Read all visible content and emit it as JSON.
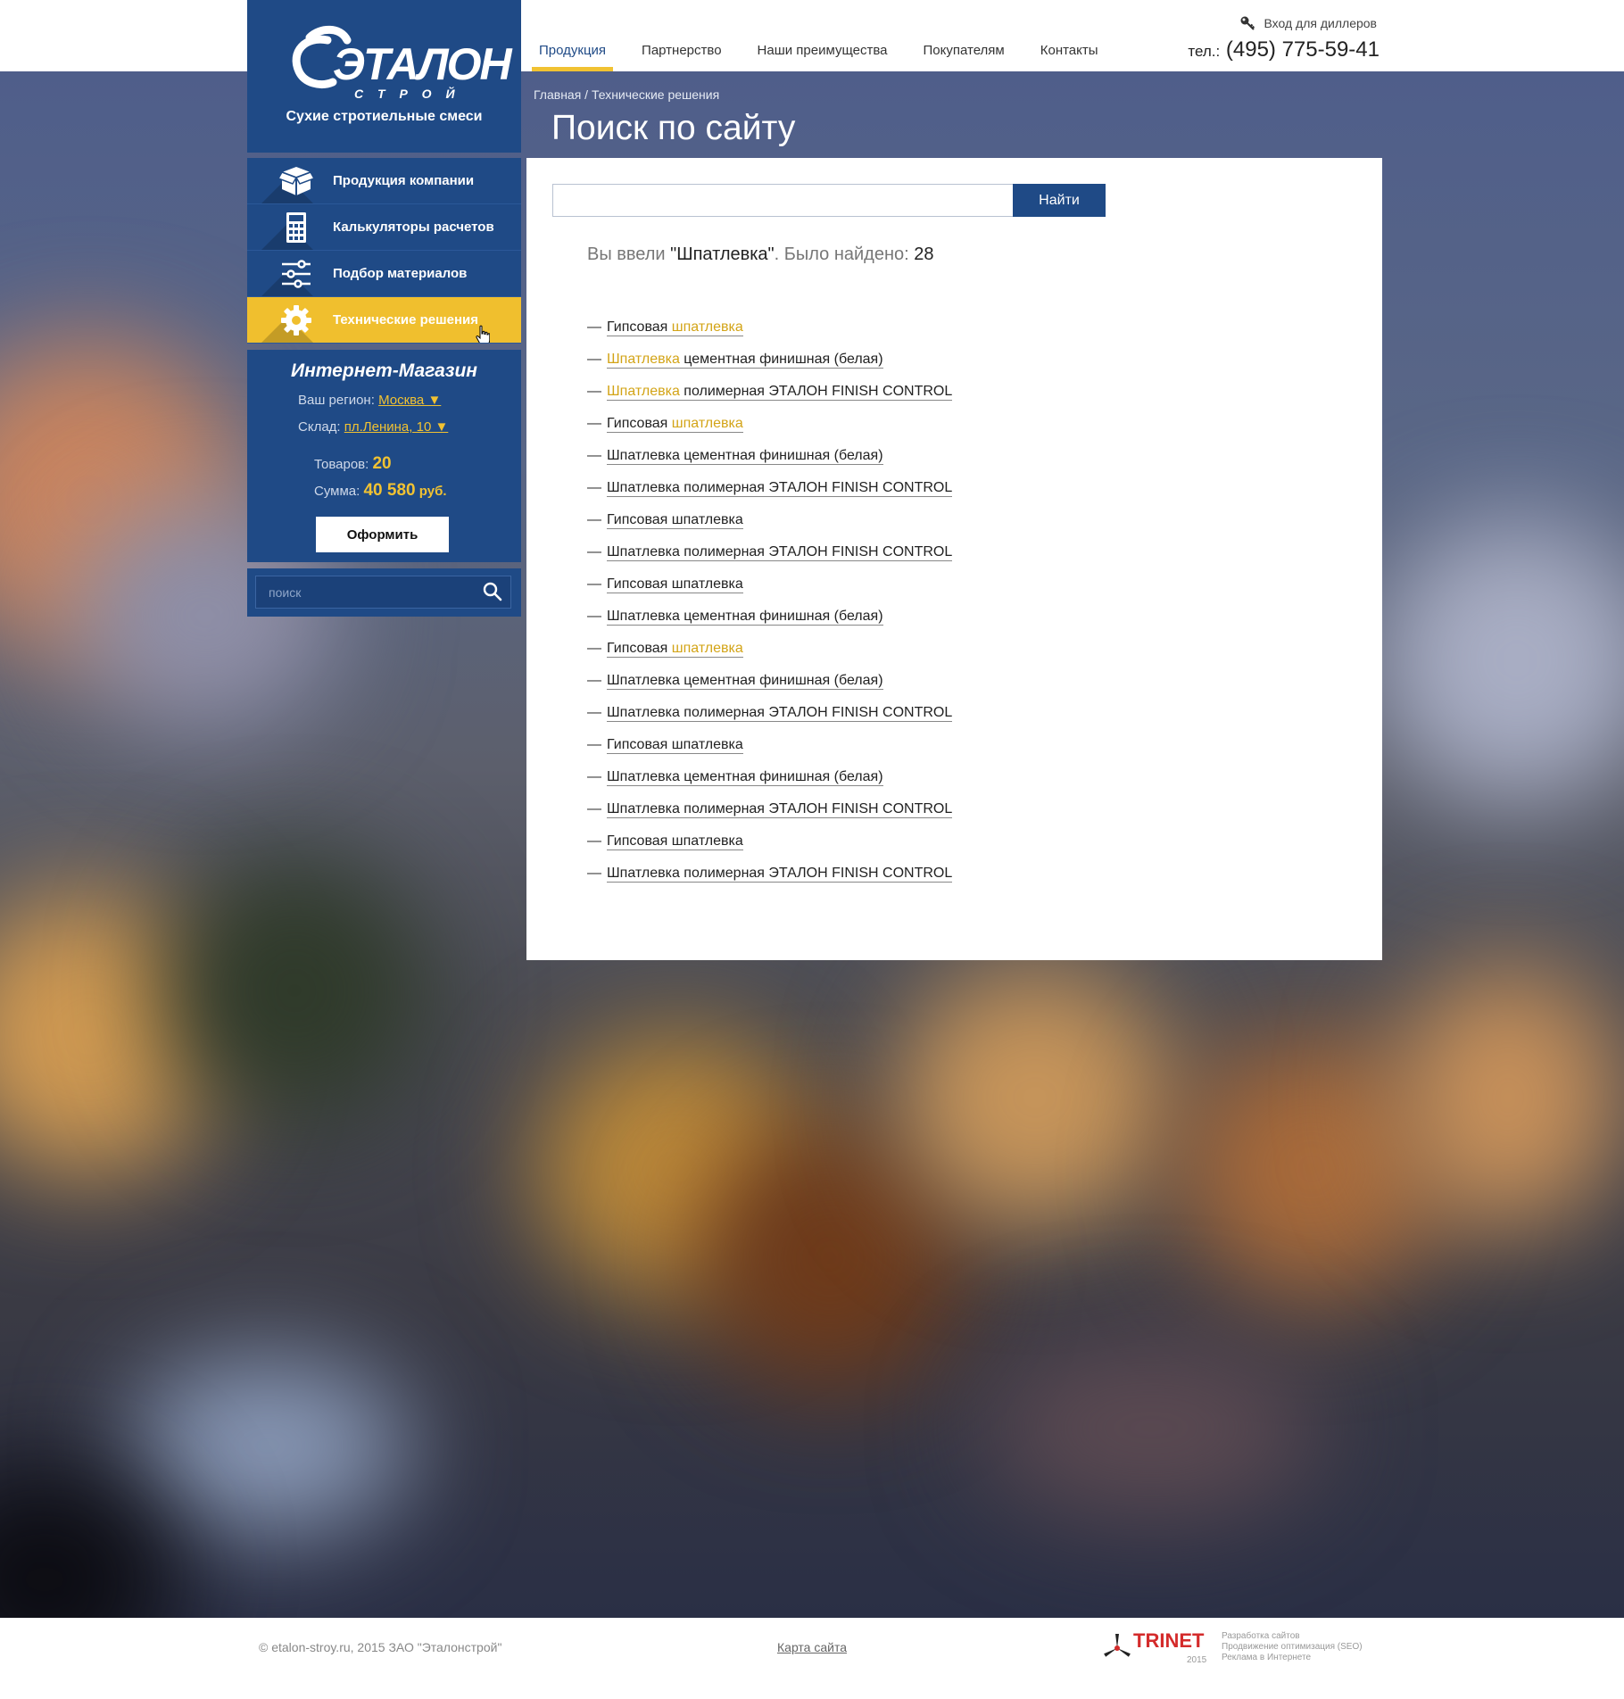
{
  "header": {
    "nav": [
      "Продукция",
      "Партнерство",
      "Наши преимущества",
      "Покупателям",
      "Контакты"
    ],
    "dealer_login": "Вход для диллеров",
    "phone_label": "тел.:",
    "phone": "(495) 775-59-41"
  },
  "logo": {
    "brand_main": "ЭТАЛОН",
    "brand_sub": "С Т Р О Й",
    "tagline": "Сухие стротиельные смеси"
  },
  "side_menu": [
    {
      "label": "Продукция компании",
      "icon": "box-icon"
    },
    {
      "label": "Калькуляторы расчетов",
      "icon": "calculator-icon"
    },
    {
      "label": "Подбор материалов",
      "icon": "sliders-icon"
    },
    {
      "label": "Технические решения",
      "icon": "gear-icon"
    }
  ],
  "shop": {
    "title": "Интернет-Магазин",
    "region_label": "Ваш регион:",
    "region_value": "Москва ▼",
    "warehouse_label": "Склад:",
    "warehouse_value": "пл.Ленина, 10 ▼",
    "items_label": "Товаров:",
    "items_value": "20",
    "sum_label": "Сумма:",
    "sum_value": "40 580",
    "sum_unit": "руб.",
    "checkout": "Оформить"
  },
  "side_search": {
    "placeholder": "поиск"
  },
  "breadcrumb": "Главная / Технические решения",
  "page_title": "Поиск по сайту",
  "search": {
    "button": "Найти",
    "summary_prefix": "Вы ввели ",
    "summary_query": "\"Шпатлевка\"",
    "summary_middle": ". Было найдено: ",
    "summary_count": "28"
  },
  "results": [
    {
      "before": "Гипсовая ",
      "hl": "шпатлевка",
      "after": ""
    },
    {
      "before": "",
      "hl": "Шпатлевка",
      "after": " цементная финишная (белая)"
    },
    {
      "before": "",
      "hl": "Шпатлевка",
      "after": " полимерная ЭТАЛОН FINISH CONTROL"
    },
    {
      "before": "Гипсовая ",
      "hl": "шпатлевка",
      "after": ""
    },
    {
      "before": "Шпатлевка цементная финишная (белая)",
      "hl": "",
      "after": ""
    },
    {
      "before": "Шпатлевка полимерная ЭТАЛОН FINISH CONTROL",
      "hl": "",
      "after": ""
    },
    {
      "before": "Гипсовая шпатлевка",
      "hl": "",
      "after": ""
    },
    {
      "before": "Шпатлевка полимерная ЭТАЛОН FINISH CONTROL",
      "hl": "",
      "after": ""
    },
    {
      "before": "Гипсовая шпатлевка",
      "hl": "",
      "after": ""
    },
    {
      "before": "Шпатлевка цементная финишная (белая)",
      "hl": "",
      "after": ""
    },
    {
      "before": "Гипсовая ",
      "hl": "шпатлевка",
      "after": ""
    },
    {
      "before": "Шпатлевка цементная финишная (белая)",
      "hl": "",
      "after": ""
    },
    {
      "before": "Шпатлевка полимерная ЭТАЛОН FINISH CONTROL",
      "hl": "",
      "after": ""
    },
    {
      "before": "Гипсовая шпатлевка",
      "hl": "",
      "after": ""
    },
    {
      "before": "Шпатлевка цементная финишная (белая)",
      "hl": "",
      "after": ""
    },
    {
      "before": "Шпатлевка полимерная ЭТАЛОН FINISH CONTROL",
      "hl": "",
      "after": ""
    },
    {
      "before": "Гипсовая шпатлевка",
      "hl": "",
      "after": ""
    },
    {
      "before": "Шпатлевка полимерная ЭТАЛОН FINISH CONTROL",
      "hl": "",
      "after": ""
    }
  ],
  "result_dash": "—",
  "footer": {
    "copyright": "© etalon-stroy.ru, 2015 ЗАО \"Эталонстрой\"",
    "sitemap": "Карта сайта",
    "dev_name": "TRINET",
    "dev_year": "2015",
    "dev_services": [
      "Разработка сайтов",
      "Продвижение оптимизация (SEO)",
      "Реклама в Интернете"
    ]
  },
  "colors": {
    "brand_blue": "#1f4a86",
    "accent_yellow": "#f1c232",
    "highlight": "#d3a417"
  }
}
